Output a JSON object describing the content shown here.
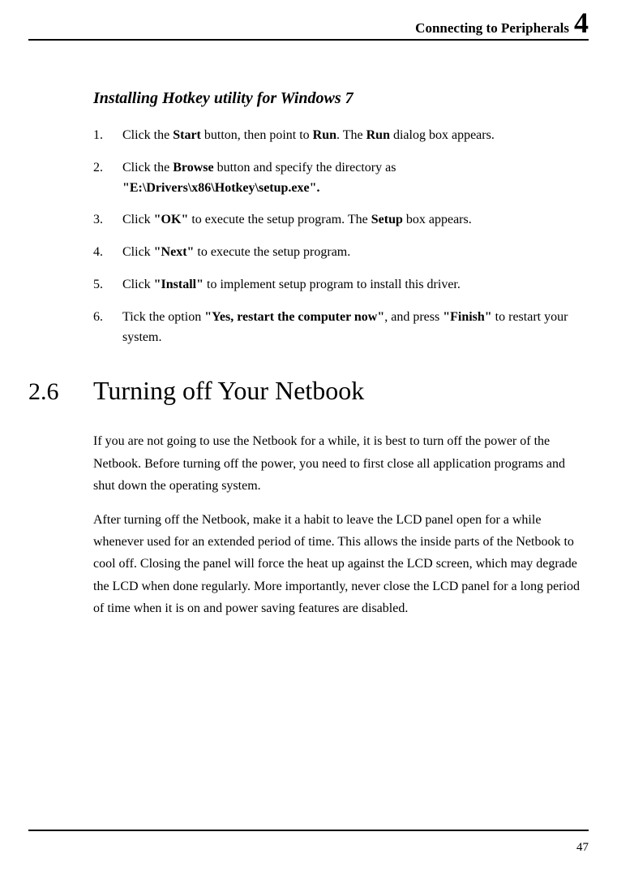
{
  "header": {
    "title": "Connecting to Peripherals",
    "chapter": "4"
  },
  "subsection": {
    "title": "Installing Hotkey utility for Windows 7"
  },
  "steps": [
    {
      "pre1": "Click the ",
      "b1": "Start",
      "mid1": " button, then point to ",
      "b2": "Run",
      "mid2": ". The ",
      "b3": "Run",
      "post": " dialog box appears."
    },
    {
      "pre1": "Click the ",
      "b1": "Browse",
      "mid1": " button and specify the directory as ",
      "b2": "\"E:\\Drivers\\x86\\Hotkey\\setup.exe\".",
      "mid2": "",
      "b3": "",
      "post": ""
    },
    {
      "pre1": "Click ",
      "b1": "\"OK\"",
      "mid1": " to execute the setup program. The ",
      "b2": "Setup",
      "mid2": " box appears.",
      "b3": "",
      "post": ""
    },
    {
      "pre1": "Click ",
      "b1": "\"Next\"",
      "mid1": " to execute the setup program.",
      "b2": "",
      "mid2": "",
      "b3": "",
      "post": ""
    },
    {
      "pre1": "Click ",
      "b1": "\"Install\"",
      "mid1": " to implement setup program to install this driver.",
      "b2": "",
      "mid2": "",
      "b3": "",
      "post": ""
    },
    {
      "pre1": "Tick the option ",
      "b1": "\"Yes, restart the computer now\"",
      "mid1": ", and press ",
      "b2": "\"Finish\"",
      "mid2": " to restart your system.",
      "b3": "",
      "post": ""
    }
  ],
  "section": {
    "number": "2.6",
    "title": "Turning off Your Netbook"
  },
  "paragraphs": {
    "p1": "If you are not going to use the Netbook for a while, it is best to turn off the power of the Netbook. Before turning off the power, you need to first close all application programs and shut down the operating system.",
    "p2": "After turning off the Netbook, make it a habit to leave the LCD panel open for a while whenever used for an extended period of time. This allows the inside parts of the Netbook to cool off. Closing the panel will force the heat up against the LCD screen, which may degrade the LCD when done regularly. More importantly, never close the LCD panel for a long period of time when it is on and power saving features are disabled."
  },
  "footer": {
    "page": "47"
  }
}
